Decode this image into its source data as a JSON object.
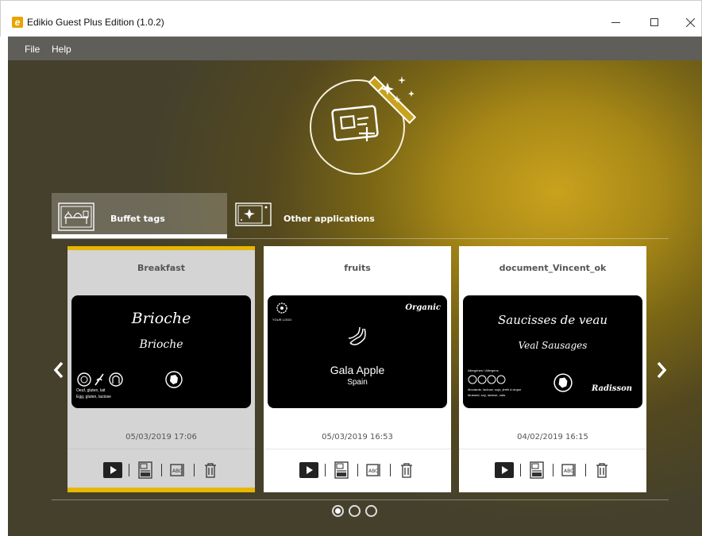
{
  "window": {
    "title": "Edikio Guest Plus Edition (1.0.2)",
    "app_icon_letter": "e"
  },
  "menu": {
    "file": "File",
    "help": "Help"
  },
  "tabs": [
    {
      "label": "Buffet tags",
      "active": true
    },
    {
      "label": "Other applications",
      "active": false
    }
  ],
  "cards": [
    {
      "title": "Breakfast",
      "date": "05/03/2019 17:06",
      "selected": true,
      "preview": {
        "line1": "Brioche",
        "line2": "Brioche",
        "allergens_1": "Oeuf, gluten, lait",
        "allergens_2": "Egg, gluten, lactose"
      }
    },
    {
      "title": "fruits",
      "date": "05/03/2019 16:53",
      "selected": false,
      "preview": {
        "line1": "Gala Apple",
        "line2": "Spain",
        "badge": "Organic",
        "logo_text": "YOUR LOGO"
      }
    },
    {
      "title": "document_Vincent_ok",
      "date": "04/02/2019 16:15",
      "selected": false,
      "preview": {
        "line1": "Saucisses de veau",
        "line2": "Veal Sausages",
        "allergens_header": "Allergènes / Allergens",
        "allergens_1": "Moutarde, lactose, soja, jéréli à cirque",
        "allergens_2": "Mustard, soy, lactose, oats",
        "brand": "Radisson"
      }
    }
  ],
  "pager": {
    "pages": 3,
    "current": 1
  },
  "colors": {
    "accent": "#e8b700",
    "menubar": "#5f5e59"
  },
  "icons": {
    "play": "play-icon",
    "template": "template-icon",
    "rename": "rename-icon",
    "delete": "trash-icon",
    "nav_left": "chevron-left-icon",
    "nav_right": "chevron-right-icon"
  }
}
